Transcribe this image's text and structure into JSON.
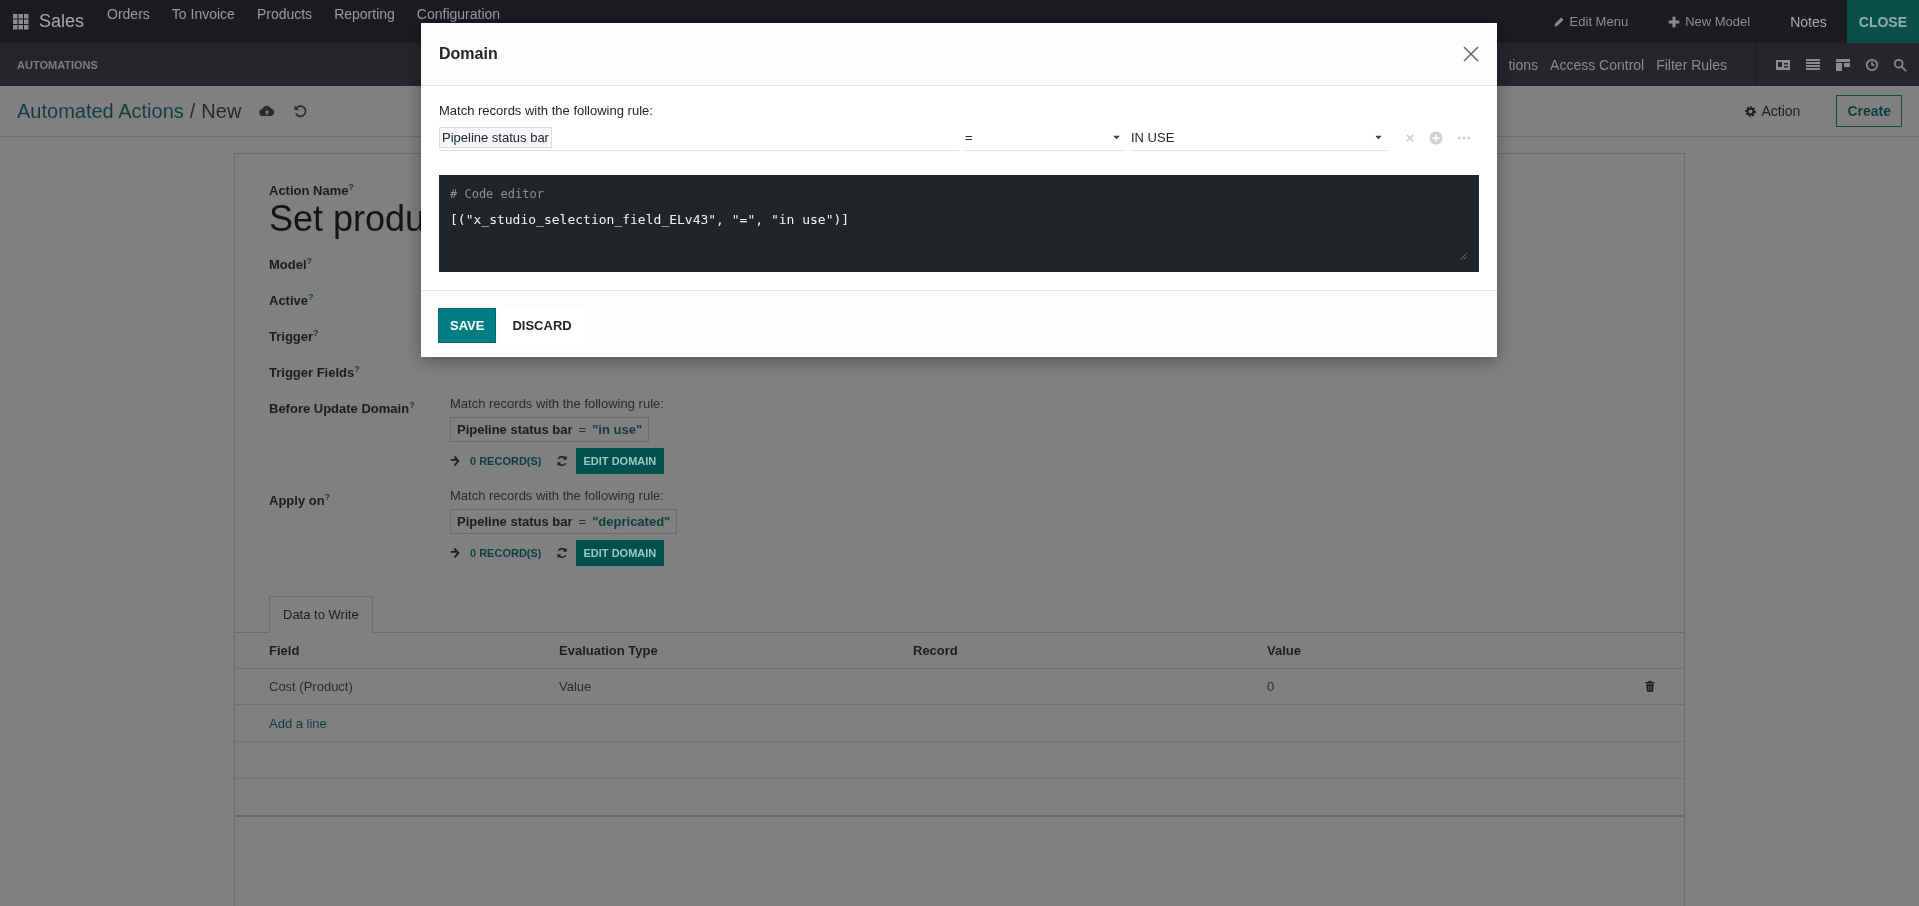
{
  "navbar": {
    "app": "Sales",
    "menu": [
      "Orders",
      "To Invoice",
      "Products",
      "Reporting",
      "Configuration"
    ],
    "edit_menu": "Edit Menu",
    "new_model": "New Model",
    "notes": "Notes",
    "close": "CLOSE"
  },
  "subbar": {
    "title": "AUTOMATIONS",
    "menu": [
      "tions",
      "Access Control",
      "Filter Rules"
    ]
  },
  "breadcrumb": {
    "parent": "Automated Actions",
    "separator": "/",
    "current": "New",
    "action": "Action",
    "create": "Create"
  },
  "form": {
    "fields": [
      {
        "kind": "title",
        "label": "Action Name$^{?}$",
        "value": "Set produ"
      },
      {
        "kind": "plain",
        "label": "Model$^{?}$"
      },
      {
        "kind": "plain",
        "label": "Active$^{?}$"
      },
      {
        "kind": "plain",
        "label": "Trigger$^{?}$"
      },
      {
        "kind": "plain",
        "label": "Trigger Fields$^{?}$"
      },
      {
        "kind": "domain",
        "label": "Before Update Domain$^{?}$",
        "intro": "Match records with the following rule:",
        "field": "Pipeline status bar",
        "operator": "=",
        "value": "\"in use\"",
        "records": "0 RECORD(S)",
        "edit": "EDIT DOMAIN"
      },
      {
        "kind": "domain",
        "label": "Apply on$^{?}$",
        "intro": "Match records with the following rule:",
        "field": "Pipeline status bar",
        "operator": "=",
        "value": "\"depricated\"",
        "records": "0 RECORD(S)",
        "edit": "EDIT DOMAIN"
      }
    ]
  },
  "tabs": [
    {
      "label": "Data to Write",
      "selected": true
    }
  ],
  "table": {
    "columns": [
      "Field",
      "Evaluation Type",
      "Record",
      "Value"
    ],
    "rows": [
      {
        "field": "Cost (Product)",
        "evaluation_type": "Value",
        "value": "0"
      }
    ],
    "add_line": "Add a line"
  },
  "modal": {
    "title": "Domain",
    "intro": "Match records with the following rule:",
    "rule": {
      "field": "Pipeline status bar",
      "operator": "=",
      "value": "IN USE"
    },
    "code_comment": "# Code editor",
    "code": "[(\"x_studio_selection_field_ELv43\", \"=\", \"in use\")]",
    "buttons": [
      {
        "label": "SAVE",
        "kind": "primary"
      },
      {
        "label": "DISCARD",
        "kind": "secondary"
      }
    ]
  }
}
